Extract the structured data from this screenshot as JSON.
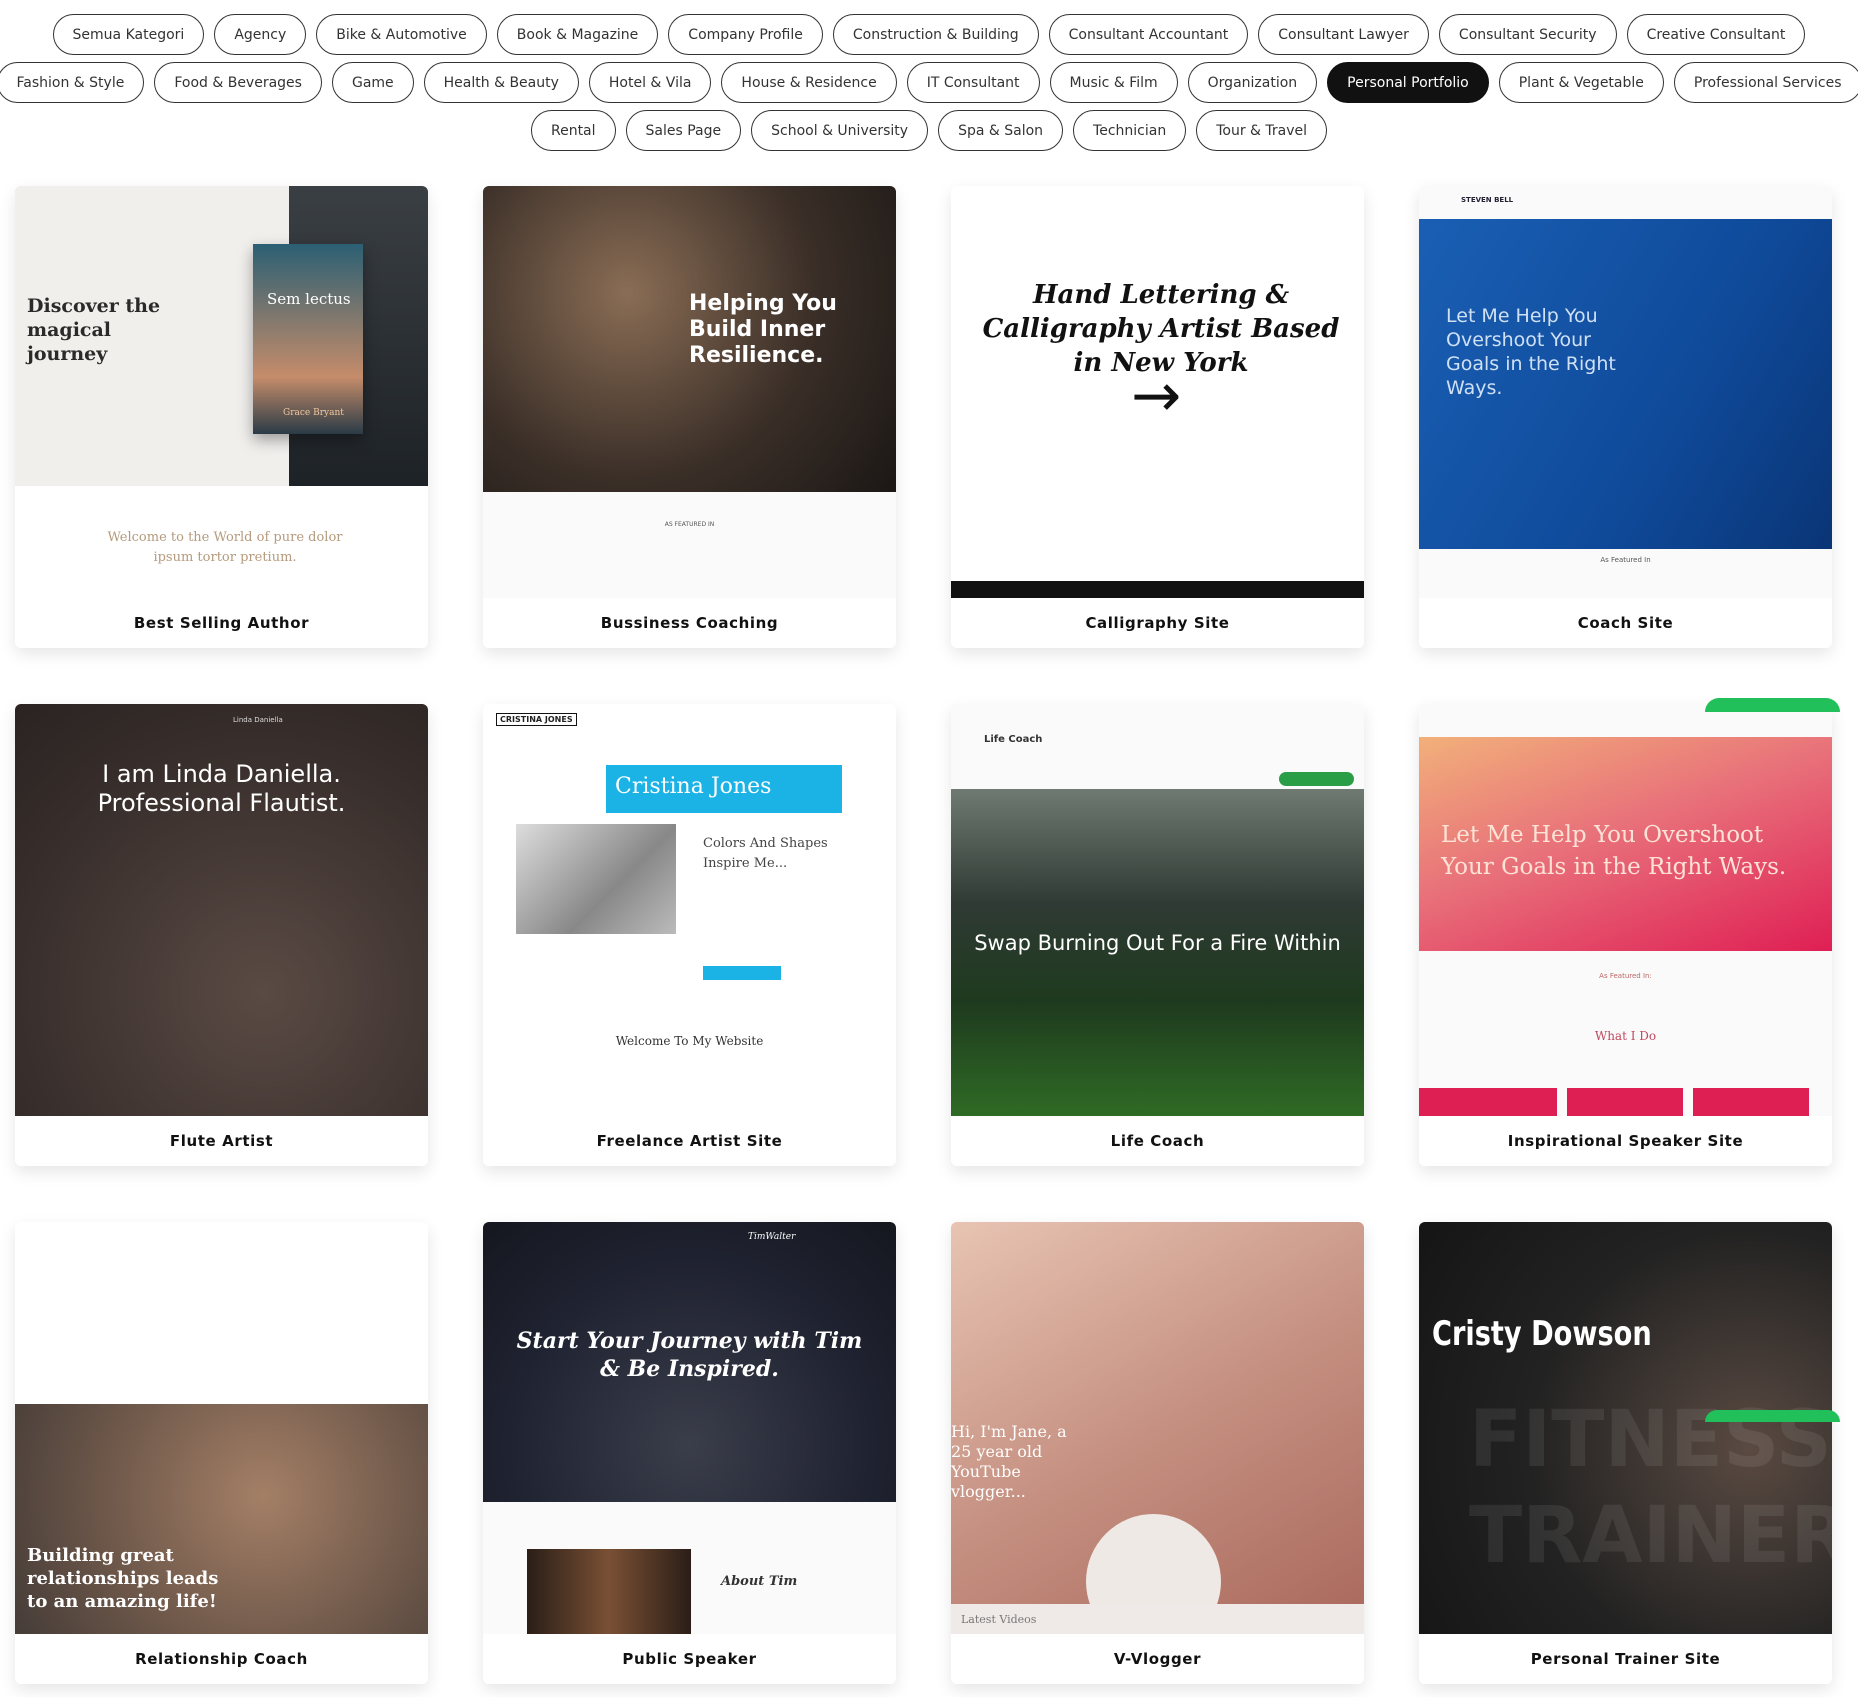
{
  "filters": {
    "rows": [
      [
        "Semua Kategori",
        "Agency",
        "Bike & Automotive",
        "Book & Magazine",
        "Company Profile",
        "Construction & Building",
        "Consultant Accountant",
        "Consultant Lawyer",
        "Consultant Security",
        "Creative Consultant"
      ],
      [
        "Fashion & Style",
        "Food & Beverages",
        "Game",
        "Health & Beauty",
        "Hotel & Vila",
        "House & Residence",
        "IT Consultant",
        "Music & Film",
        "Organization",
        "Personal Portfolio",
        "Plant & Vegetable",
        "Professional Services"
      ],
      [
        "Rental",
        "Sales Page",
        "School & University",
        "Spa & Salon",
        "Technician",
        "Tour & Travel"
      ]
    ],
    "active": "Personal Portfolio"
  },
  "accent_color": "#111111",
  "cards": [
    {
      "title": "Best Selling Author",
      "heading": "Discover the magical journey",
      "texts": [
        "Sem lectus",
        "Grace Bryant",
        "Welcome to the World of pure dolor ipsum tortor pretium."
      ]
    },
    {
      "title": "Bussiness Coaching",
      "heading": "Helping You Build Inner Resilience.",
      "texts": [
        "AS FEATURED IN"
      ]
    },
    {
      "title": "Calligraphy Site",
      "heading": "Hand Lettering & Calligraphy Artist Based in New York",
      "texts": [
        "→"
      ]
    },
    {
      "title": "Coach Site",
      "heading": "Let Me Help You Overshoot Your Goals in the Right Ways.",
      "texts": [
        "STEVEN BELL",
        "As Featured In"
      ]
    },
    {
      "title": "Flute Artist",
      "heading": "I am Linda Daniella. Professional Flautist.",
      "texts": [
        "Linda Daniella"
      ]
    },
    {
      "title": "Freelance Artist Site",
      "heading": "Cristina Jones",
      "texts": [
        "Colors And Shapes Inspire Me...",
        "Welcome To My Website",
        "CRISTINA JONES"
      ]
    },
    {
      "title": "Life Coach",
      "heading": "Swap Burning Out For a Fire Within",
      "texts": [
        "Life Coach"
      ]
    },
    {
      "title": "Inspirational Speaker Site",
      "heading": "Let Me Help You Overshoot Your Goals in the Right Ways.",
      "texts": [
        "As Featured In:",
        "What I Do"
      ]
    },
    {
      "title": "Relationship Coach",
      "heading": "Building great relationships leads to an amazing life!",
      "texts": []
    },
    {
      "title": "Public Speaker",
      "heading": "Start Your Journey with Tim & Be Inspired.",
      "texts": [
        "TimWalter",
        "About Tim"
      ]
    },
    {
      "title": "V-Vlogger",
      "heading": "Hi, I'm Jane, a 25 year old YouTube vlogger...",
      "texts": [
        "Latest Videos"
      ]
    },
    {
      "title": "Personal Trainer Site",
      "heading": "Cristy Dowson",
      "texts": [
        "FITNESS TRAINER"
      ]
    }
  ]
}
